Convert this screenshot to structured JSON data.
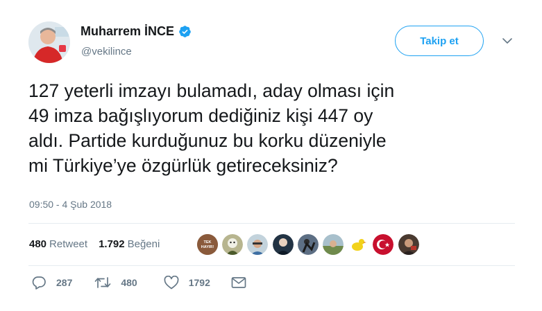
{
  "user": {
    "name": "Muharrem İNCE",
    "handle": "@vekilince",
    "avatar_icon": "profile-photo"
  },
  "follow_button": {
    "label": "Takip et"
  },
  "tweet": {
    "text": "127 yeterli imzayı bulamadı, aday olması için\n49 imza bağışlıyorum dediğiniz kişi 447 oy\naldı. Partide kurduğunuz bu korku düzeniyle\nmi Türkiye’ye özgürlük getireceksiniz?",
    "timestamp": "09:50 - 4 Şub 2018"
  },
  "stats": {
    "retweet_count": "480",
    "retweet_label": "Retweet",
    "like_count": "1.792",
    "like_label": "Beğeni"
  },
  "likers": [
    {
      "icon": "liker-avatar",
      "color": "#8a5a3b",
      "text": "TEK HAYIR!"
    },
    {
      "icon": "liker-avatar",
      "color": "#6f7a3a"
    },
    {
      "icon": "liker-avatar",
      "color": "#7d8f9a"
    },
    {
      "icon": "liker-avatar",
      "color": "#223344"
    },
    {
      "icon": "liker-avatar",
      "color": "#3a4a5c"
    },
    {
      "icon": "liker-avatar",
      "color": "#7a8c6a"
    },
    {
      "icon": "liker-avatar",
      "color": "#f2d21b"
    },
    {
      "icon": "liker-avatar",
      "color": "#c8102e"
    },
    {
      "icon": "liker-avatar",
      "color": "#4a3a30"
    }
  ],
  "actions": {
    "reply_count": "287",
    "retweet_count": "480",
    "like_count": "1792"
  },
  "colors": {
    "accent": "#1da1f2",
    "text": "#14171a",
    "muted": "#657786",
    "divider": "#e6ecf0"
  }
}
